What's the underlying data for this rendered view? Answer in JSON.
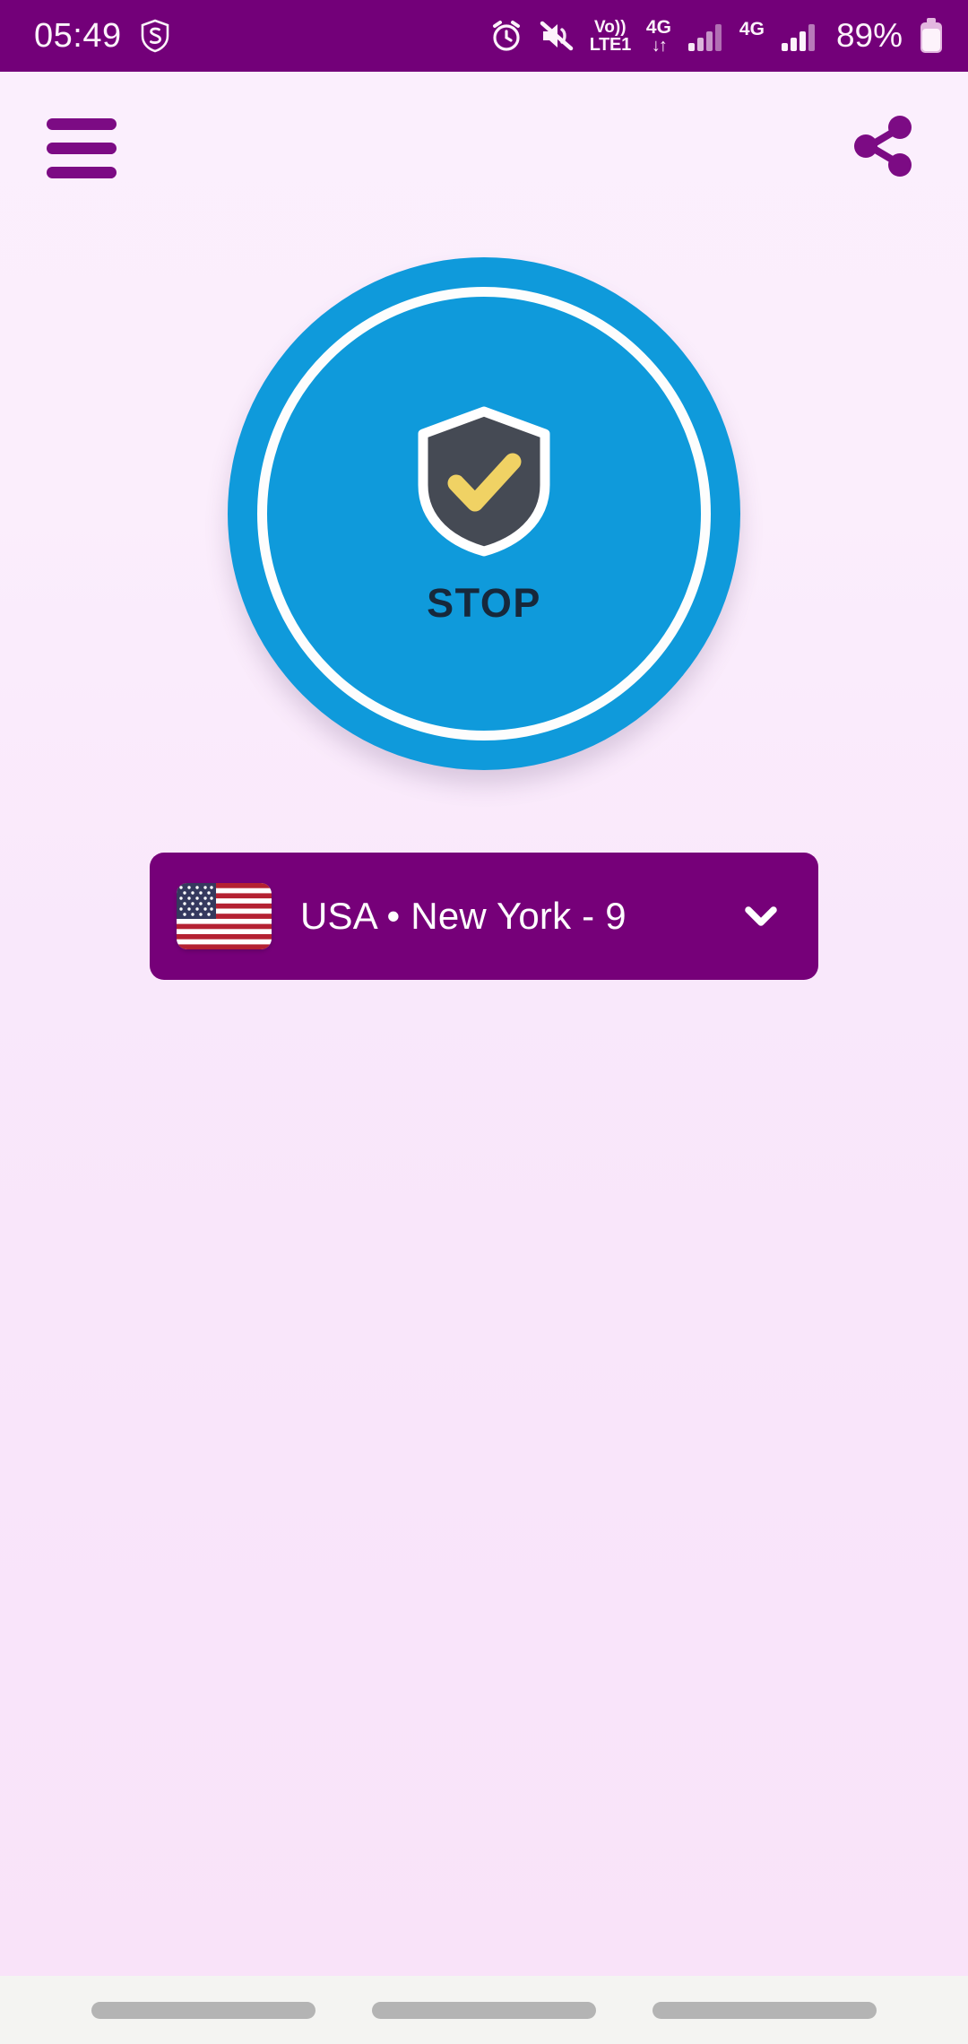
{
  "status_bar": {
    "time": "05:49",
    "battery_percent": "89%",
    "volte_label_top": "Vo))",
    "volte_label_bottom": "LTE1",
    "network_label_1": "4G",
    "network_label_2": "4G",
    "data_arrows": "↓↑",
    "icons": [
      "security-shield-icon",
      "alarm-icon",
      "mute-icon",
      "volte-icon",
      "signal-bars-sim1-icon",
      "signal-bars-sim2-icon",
      "battery-icon"
    ],
    "background_color": "#730079",
    "foreground_color": "#fdf3fb"
  },
  "header": {
    "menu_label": "Menu",
    "share_label": "Share",
    "icon_color": "#7c0b84"
  },
  "connection": {
    "state_label": "STOP",
    "button_color": "#0f9adb",
    "ring_color": "#fdfdfd",
    "label_color": "#17283b",
    "shield_body_color": "#454a54",
    "shield_check_color": "#f0d264",
    "shield_outline_color": "#ffffff"
  },
  "server_selector": {
    "name": "USA • New York - 9",
    "country": "USA",
    "city": "New York",
    "number": "9",
    "flag": "us-flag-icon",
    "chevron": "chevron-down-icon",
    "background_color": "#760079",
    "text_color": "#ffffff"
  },
  "nav_bar": {
    "buttons": [
      "recents-button",
      "home-button",
      "back-button"
    ],
    "pill_color": "#b4b4b4",
    "background_color": "#f4f4f2"
  },
  "theme": {
    "page_background_top": "#fbeffd",
    "page_background_bottom": "#f9e3f9",
    "brand_purple": "#730079"
  }
}
